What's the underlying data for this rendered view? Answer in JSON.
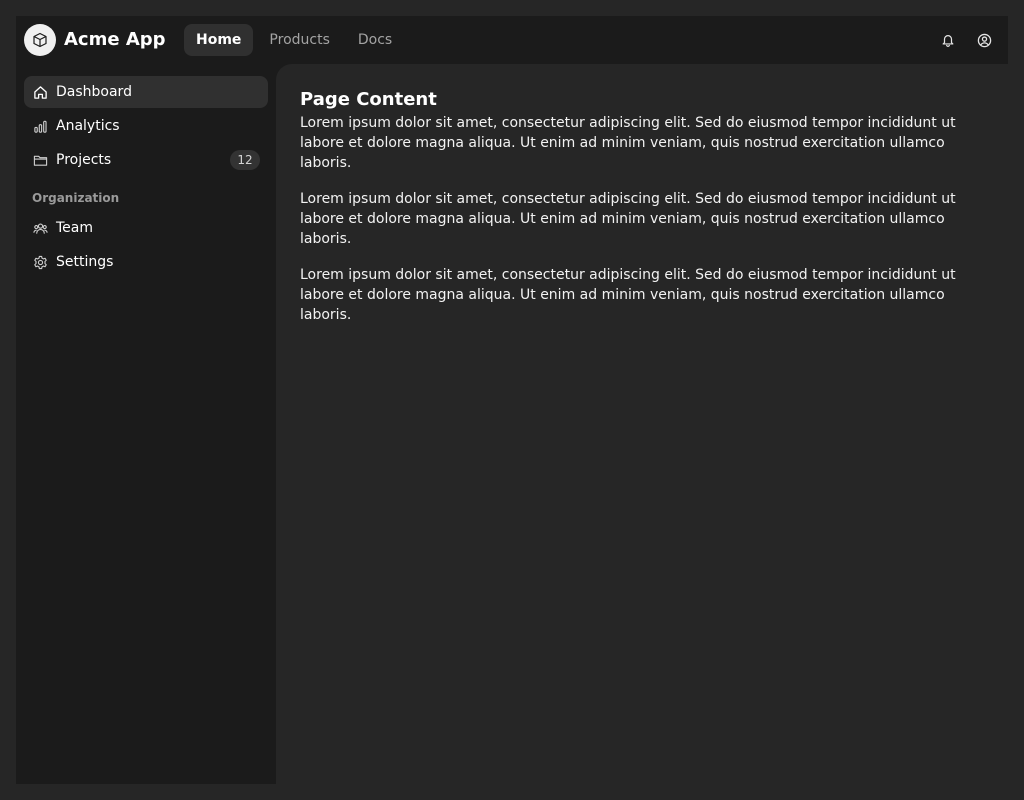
{
  "app": {
    "title": "Acme App",
    "logo_icon": "cube-icon"
  },
  "nav": {
    "items": [
      {
        "label": "Home",
        "active": true
      },
      {
        "label": "Products",
        "active": false
      },
      {
        "label": "Docs",
        "active": false
      }
    ]
  },
  "header_icons": [
    "bell-icon",
    "user-circle-icon"
  ],
  "sidebar": {
    "items": [
      {
        "label": "Dashboard",
        "icon": "home-icon",
        "active": true
      },
      {
        "label": "Analytics",
        "icon": "bar-chart-icon"
      },
      {
        "label": "Projects",
        "icon": "folder-icon",
        "badge": "12"
      }
    ],
    "section_title": "Organization",
    "org_items": [
      {
        "label": "Team",
        "icon": "users-icon"
      },
      {
        "label": "Settings",
        "icon": "gear-icon"
      }
    ]
  },
  "main": {
    "title": "Page Content",
    "paragraphs": [
      "Lorem ipsum dolor sit amet, consectetur adipiscing elit. Sed do eiusmod tempor incididunt ut labore et dolore magna aliqua. Ut enim ad minim veniam, quis nostrud exercitation ullamco laboris.",
      "Lorem ipsum dolor sit amet, consectetur adipiscing elit. Sed do eiusmod tempor incididunt ut labore et dolore magna aliqua. Ut enim ad minim veniam, quis nostrud exercitation ullamco laboris.",
      "Lorem ipsum dolor sit amet, consectetur adipiscing elit. Sed do eiusmod tempor incididunt ut labore et dolore magna aliqua. Ut enim ad minim veniam, quis nostrud exercitation ullamco laboris."
    ]
  },
  "colors": {
    "background": "#262626",
    "panel": "#1b1b1b",
    "active": "#303030",
    "text": "#ffffff",
    "muted": "#a3a3a3"
  }
}
